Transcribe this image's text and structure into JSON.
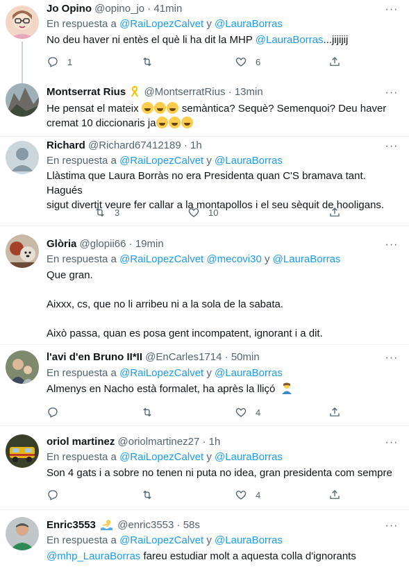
{
  "tweets": [
    {
      "name": "Jo Opino",
      "handle": "@opino_jo",
      "time": "41min",
      "reply_prefix": "En respuesta a",
      "reply_mentions": [
        "@RaiLopezCalvet",
        "@LauraBorras"
      ],
      "reply_joiner": "y",
      "text_a": "No deu haver ni entès el què li ha dit la MHP",
      "text_mention": "@LauraBorras",
      "text_b": "...jijijij",
      "replies": "1",
      "retweets": "",
      "likes": "6"
    },
    {
      "name": "Montserrat Rius",
      "handle": "@MontserratRius",
      "time": "13min",
      "text_line1": "He pensat el mateix",
      "text_line1b": "semàntica? Sequè? Semenquoi? Deu haver",
      "text_line2": "cremat 10 diccionaris ja"
    },
    {
      "name": "Richard",
      "handle": "@Richard67412189",
      "time": "1h",
      "reply_prefix": "En respuesta a",
      "reply_mentions": [
        "@RaiLopezCalvet",
        "@LauraBorras"
      ],
      "reply_joiner": "y",
      "text_line1": "Llàstima que Laura Borràs no era Presidenta quan C'S bramava tant. Hagués",
      "text_line2": "sigut divertit veure fer callar a la montapollos i el seu sèquit de hooligans.",
      "replies": "",
      "retweets": "3",
      "likes": "10"
    },
    {
      "name": "Glòria",
      "handle": "@glopii66",
      "time": "19min",
      "reply_prefix": "En respuesta a",
      "reply_mentions": [
        "@RaiLopezCalvet",
        "@mecovi30",
        "@LauraBorras"
      ],
      "reply_joiner": "y",
      "text_p1": "Que gran.",
      "text_p2": "Aixxx, cs, que no li arribeu ni a la sola de la sabata.",
      "text_p3": "Això passa, quan es posa gent incompatent, ignorant i a dit."
    },
    {
      "name": "l'avi d'en Bruno II*II",
      "handle": "@EnCarles1714",
      "time": "50min",
      "reply_prefix": "En respuesta a",
      "reply_mentions": [
        "@RaiLopezCalvet",
        "@LauraBorras"
      ],
      "reply_joiner": "y",
      "text_line1": "Almenys en Nacho està formalet, ha après la lliçó",
      "replies": "",
      "retweets": "",
      "likes": "4"
    },
    {
      "name": "oriol martinez",
      "handle": "@oriolmartinez27",
      "time": "1h",
      "reply_prefix": "En respuesta a",
      "reply_mentions": [
        "@RaiLopezCalvet",
        "@LauraBorras"
      ],
      "reply_joiner": "y",
      "text_line1": "Son 4 gats i a sobre no tenen ni puta no idea, gran presidenta com sempre",
      "replies": "",
      "retweets": "",
      "likes": "4"
    },
    {
      "name": "Enric3553",
      "handle": "@enric3553",
      "time": "58s",
      "reply_prefix": "En respuesta a",
      "reply_mentions": [
        "@RaiLopezCalvet",
        "@LauraBorras"
      ],
      "reply_joiner": "y",
      "text_mention": "@mhp_LauraBorras",
      "text_b": "fareu estudiar molt a aquesta colla d'ignorants"
    }
  ],
  "separator": "·",
  "more_glyph": "···",
  "colors": {
    "link": "#1d9bf0",
    "secondary": "#536471",
    "divider": "#eff3f4",
    "thread_line": "#c4cfd6"
  },
  "icons": [
    "reply-icon",
    "retweet-icon",
    "like-icon",
    "share-icon",
    "more-icon",
    "yellow-ribbon-icon",
    "laughing-emoji",
    "shrug-emoji",
    "swimmer-emoji"
  ]
}
